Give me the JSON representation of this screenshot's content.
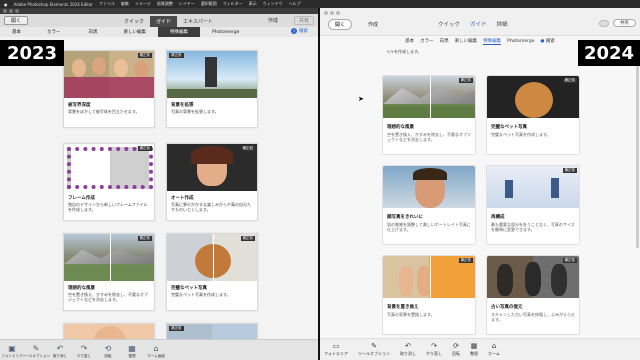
{
  "mac_menu": [
    "Adobe Photoshop Elements 2024 Editor",
    "ファイル",
    "編集",
    "イメージ",
    "画質調整",
    "レイヤー",
    "選択範囲",
    "フィルター",
    "表示",
    "ウィンドウ",
    "ヘルプ"
  ],
  "left": {
    "open_label": "開く",
    "modes": [
      "クイック",
      "ガイド",
      "エキスパート"
    ],
    "active_mode": 1,
    "create_label": "作成",
    "share_label": "共有",
    "tabs": [
      "基本",
      "カラー",
      "白黒",
      "楽しい編集",
      "特殊編集",
      "Photomerge"
    ],
    "active_tab": 4,
    "help_label": "検索",
    "badge": "2023",
    "cards": [
      {
        "tag": "補正前",
        "title": "被写界深度",
        "desc": "背景をぼかして被写体を目立たせます。"
      },
      {
        "tag": "補正前",
        "title": "背景を拡張",
        "desc": "写真の背景を拡張します。"
      },
      {
        "tag": "補正前",
        "title": "フレーム作成",
        "desc": "独自のデザインから新しいフレームファイルを作成します。"
      },
      {
        "tag": "補正前",
        "title": "オート作成",
        "desc": "写真に夢のかかるな楽しみからや真の自分たちものいとくします。"
      },
      {
        "tag": "補正前",
        "title": "理想的な風景",
        "desc": "空を置き換え、かすみを除去し、不要なオブジェクトなどを消去します。"
      },
      {
        "tag": "補正前",
        "title": "完璧なペット写真",
        "desc": "完璧なペット写真を作成します。"
      },
      {
        "tag": "補正前",
        "title": "",
        "desc": ""
      },
      {
        "tag": "補正前",
        "title": "",
        "desc": ""
      }
    ],
    "tools": [
      "フォトエリア",
      "ツールオプション",
      "取り消し",
      "やり直し",
      "回転",
      "整理",
      "ホーム画面"
    ]
  },
  "right": {
    "open_label": "開く",
    "create_label": "作成",
    "modes": [
      "クイック",
      "ガイド",
      "詳細"
    ],
    "active_mode": 1,
    "share_label": "共有",
    "tabs": [
      "基本",
      "カラー",
      "白黒",
      "楽しい編集",
      "特殊編集",
      "Photomerge",
      "検索"
    ],
    "active_tab": 4,
    "badge": "2024",
    "top_text": "イルを作成します。",
    "cards": [
      {
        "tag": "補正前",
        "title": "理想的な風景",
        "desc": "空を置き換え、かすみを除去し、不要なオブジェクトなどを消去します。"
      },
      {
        "tag": "補正前",
        "title": "完璧なペット写真",
        "desc": "完璧なペット写真を作成します。"
      },
      {
        "tag": "補正前",
        "title": "顔写真をきれいに",
        "desc": "肌の質感を調整して美しいポートレイト写真に仕上げます。"
      },
      {
        "tag": "補正前",
        "title": "再構成",
        "desc": "最も重要な部分を失うことなく、写真のサイズを簡単に変更できます。"
      },
      {
        "tag": "補正前",
        "title": "背景を置き換え",
        "desc": "写真の背景を置換します。"
      },
      {
        "tag": "補正前",
        "title": "古い写真の復元",
        "desc": "スキャンした古い写真を修復し、よみがえらせます。"
      }
    ],
    "tools": [
      "フォトエリア",
      "ツールオプション",
      "取り消し",
      "やり直し",
      "回転",
      "整理",
      "ホーム"
    ]
  },
  "colors": {
    "accent": "#2a62c9",
    "dark_tab": "#3d3d3d"
  }
}
